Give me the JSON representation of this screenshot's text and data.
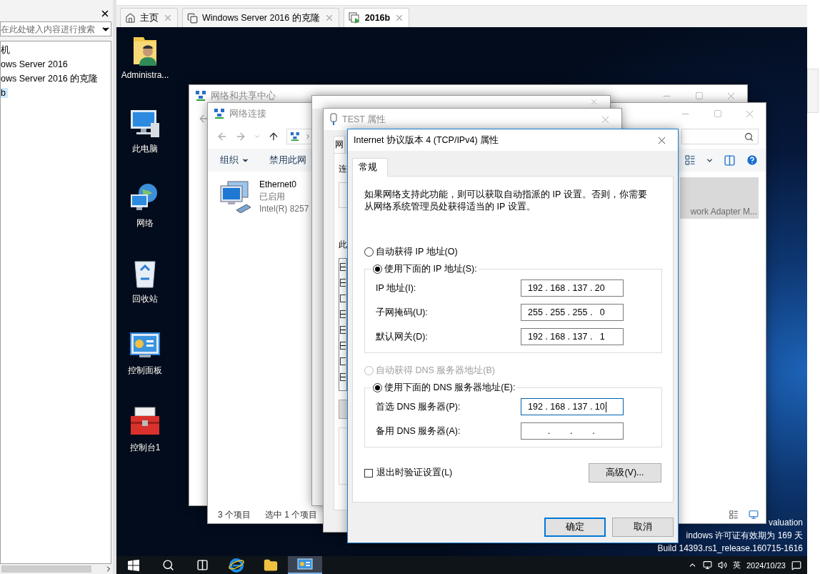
{
  "sidebar": {
    "search": {
      "placeholder": "在此处键入内容进行搜索"
    },
    "tree": [
      {
        "label": "机",
        "selected": false,
        "children": [
          {
            "label": "ows Server 2016",
            "selected": false
          },
          {
            "label": "ows Server 2016 的克隆",
            "selected": false
          },
          {
            "label": "b",
            "selected": true
          }
        ]
      }
    ]
  },
  "tabs": [
    {
      "label": "主页",
      "kind": "home",
      "selected": false
    },
    {
      "label": "Windows Server 2016 的克隆",
      "kind": "vm",
      "selected": false
    },
    {
      "label": "2016b",
      "kind": "vm-running",
      "selected": true
    }
  ],
  "desktop_icons": [
    {
      "label": "Administra...",
      "kind": "user-folder"
    },
    {
      "label": "此电脑",
      "kind": "computer"
    },
    {
      "label": "网络",
      "kind": "network"
    },
    {
      "label": "回收站",
      "kind": "recycle-bin"
    },
    {
      "label": "控制面板",
      "kind": "control-panel"
    },
    {
      "label": "控制台1",
      "kind": "toolbox"
    }
  ],
  "sharing_center": {
    "title": "网络和共享中心",
    "active": false
  },
  "connections": {
    "title": "网络连接",
    "active": false,
    "toolbar": [
      {
        "label": "组织",
        "dropdown": true
      },
      {
        "label": "禁用此网",
        "dropdown": false
      }
    ],
    "items": [
      {
        "name": "Ethernet0",
        "status": "已启用",
        "device": "Intel(R) 8257",
        "selected": false
      },
      {
        "device": "work Adapter M...",
        "selected": true
      }
    ],
    "status": [
      "3 个项目",
      "选中 1 个项目"
    ]
  },
  "adapter_properties": {
    "title": "TEST 属性",
    "active": false,
    "tab": "网",
    "labels": [
      "连",
      "此"
    ],
    "components": [
      {
        "checked": true
      },
      {
        "checked": true
      },
      {
        "checked": false
      },
      {
        "checked": true
      },
      {
        "checked": true
      },
      {
        "checked": true
      },
      {
        "checked": false
      },
      {
        "checked": true
      }
    ]
  },
  "ipv4_dialog": {
    "title": "Internet 协议版本 4 (TCP/IPv4) 属性",
    "active": true,
    "tabs": [
      {
        "label": "常规",
        "selected": true
      }
    ],
    "description": "如果网络支持此功能，则可以获取自动指派的 IP 设置。否则，你需要从网络系统管理员处获得适当的 IP 设置。",
    "ip_options": [
      {
        "label": "自动获得 IP 地址(O)",
        "selected": false,
        "disabled": false
      },
      {
        "label": "使用下面的 IP 地址(S):",
        "selected": true,
        "disabled": false
      }
    ],
    "ip_fields": [
      {
        "label": "IP 地址(I):",
        "value": "192 . 168 . 137 . 20",
        "focused": false
      },
      {
        "label": "子网掩码(U):",
        "value": "255 . 255 . 255 .   0",
        "focused": false
      },
      {
        "label": "默认网关(D):",
        "value": "192 . 168 . 137 .   1",
        "focused": false
      }
    ],
    "dns_options": [
      {
        "label": "自动获得 DNS 服务器地址(B)",
        "selected": false,
        "disabled": true
      },
      {
        "label": "使用下面的 DNS 服务器地址(E):",
        "selected": true,
        "disabled": false
      }
    ],
    "dns_fields": [
      {
        "label": "首选 DNS 服务器(P):",
        "value": "192 . 168 . 137 . 10",
        "focused": true
      },
      {
        "label": "备用 DNS 服务器(A):",
        "value": "        .        .        .",
        "focused": false
      }
    ],
    "validate_on_exit": {
      "label": "退出时验证设置(L)",
      "checked": false
    },
    "advanced_button": "高级(V)...",
    "buttons": [
      {
        "label": "确定",
        "default": true
      },
      {
        "label": "取消",
        "default": false
      }
    ]
  },
  "desktop_info": [
    "valuation",
    "indows 许可证有效期为 169 天",
    "Build 14393.rs1_release.160715-1616"
  ],
  "taskbar": {
    "apps": [
      {
        "kind": "start",
        "active": false
      },
      {
        "kind": "search",
        "active": false
      },
      {
        "kind": "task-view",
        "active": false
      },
      {
        "kind": "browser",
        "active": false
      },
      {
        "kind": "explorer",
        "active": false
      },
      {
        "kind": "control-panel",
        "active": true
      }
    ],
    "ime": "英",
    "date": "2024/10/23"
  }
}
